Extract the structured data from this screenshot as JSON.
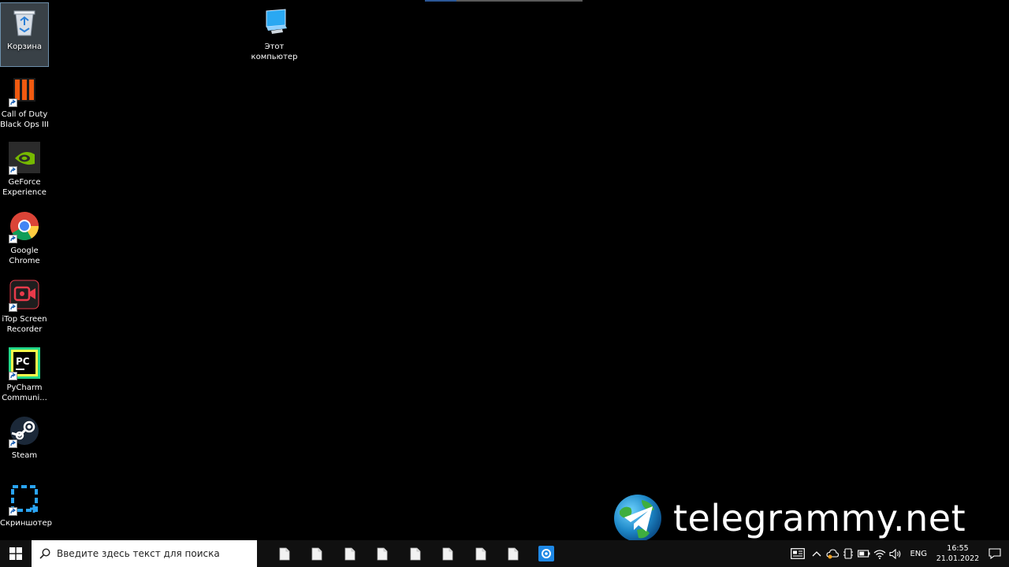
{
  "desktop": {
    "icons": [
      {
        "label": "Корзина",
        "icon": "recycle-bin-icon"
      },
      {
        "label": "Этот\nкомпьютер",
        "icon": "this-pc-icon"
      },
      {
        "label": "Call of Duty\nBlack Ops III",
        "icon": "black-ops-icon"
      },
      {
        "label": "GeForce\nExperience",
        "icon": "geforce-icon"
      },
      {
        "label": "Google\nChrome",
        "icon": "chrome-icon"
      },
      {
        "label": "iTop Screen\nRecorder",
        "icon": "itop-recorder-icon"
      },
      {
        "label": "PyCharm\nCommuni...",
        "icon": "pycharm-icon"
      },
      {
        "label": "Steam",
        "icon": "steam-icon"
      },
      {
        "label": "Скриншотер",
        "icon": "screenshoter-icon"
      }
    ]
  },
  "watermark": {
    "text": "telegrammy.net"
  },
  "taskbar": {
    "search_placeholder": "Введите здесь текст для поиска",
    "language": "ENG",
    "time": "16:55",
    "date": "21.01.2022"
  },
  "colors": {
    "taskbar": "#101010",
    "accent": "#0078d7"
  }
}
